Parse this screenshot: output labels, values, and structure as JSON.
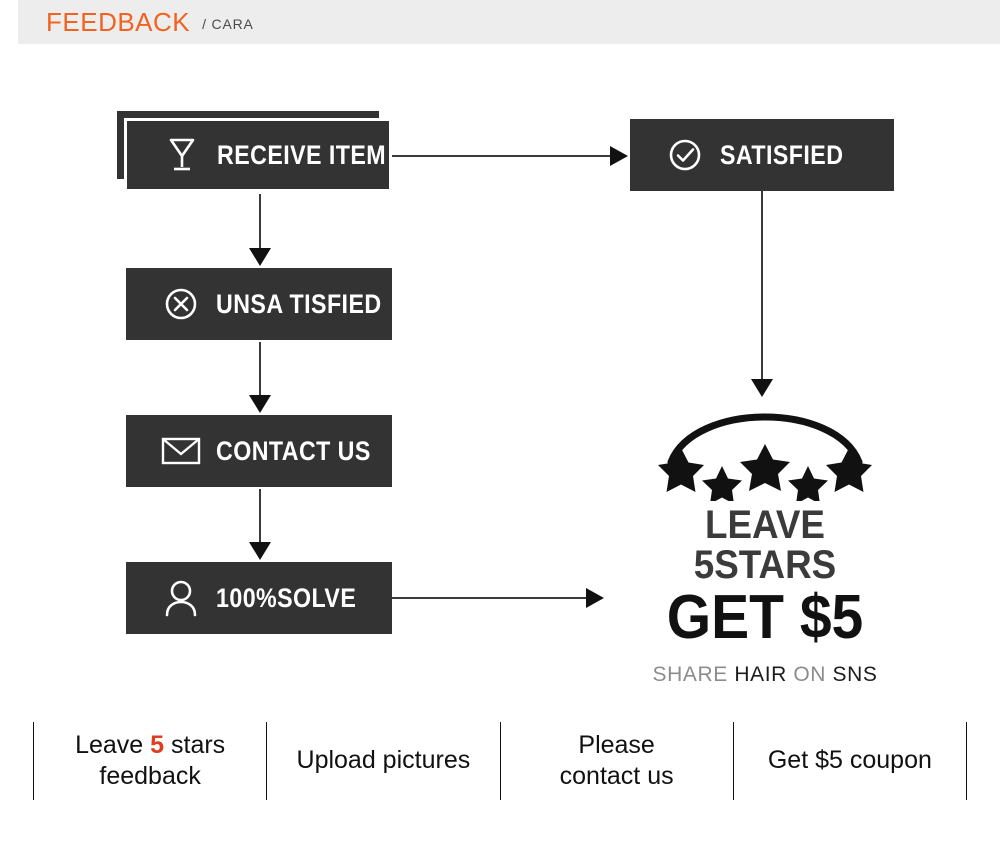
{
  "header": {
    "title": "FEEDBACK",
    "subtitle": "/ CARA",
    "title_color": "#f26322",
    "band_color": "#ededed"
  },
  "flow": {
    "box_color": "#333333",
    "text_color": "#ffffff",
    "boxes": [
      {
        "id": "receive",
        "label": "RECEIVE ITEM",
        "icon": "wine-glass-icon",
        "stacked": true
      },
      {
        "id": "satisfied",
        "label": "SATISFIED",
        "icon": "check-circle-icon",
        "stacked": false
      },
      {
        "id": "unsat",
        "label": "UNSA TISFIED",
        "icon": "x-circle-icon",
        "stacked": false
      },
      {
        "id": "contact",
        "label": "CONTACT US",
        "icon": "envelope-icon",
        "stacked": false
      },
      {
        "id": "solve",
        "label": "100%SOLVE",
        "icon": "person-icon",
        "stacked": false
      }
    ],
    "arrows": [
      {
        "id": "receive-to-satisfied",
        "direction": "right"
      },
      {
        "id": "receive-to-unsatisfied",
        "direction": "down"
      },
      {
        "id": "unsatisfied-to-contact",
        "direction": "down"
      },
      {
        "id": "contact-to-solve",
        "direction": "down"
      },
      {
        "id": "solve-to-stars",
        "direction": "right"
      },
      {
        "id": "satisfied-to-stars",
        "direction": "down"
      }
    ]
  },
  "badge": {
    "stars_count": 5,
    "line1": "LEAVE 5STARS",
    "line2": "GET $5",
    "line3_words": [
      {
        "text": "SHARE",
        "tone": "gray"
      },
      {
        "text": "HAIR",
        "tone": "dark"
      },
      {
        "text": "ON",
        "tone": "gray"
      },
      {
        "text": "SNS",
        "tone": "dark"
      }
    ],
    "line1_color": "#3b3b3b",
    "line2_color": "#111111"
  },
  "bottom": {
    "highlight_color": "#e03c20",
    "cells": [
      {
        "id": "leave-stars",
        "pre": "Leave ",
        "highlight": "5",
        "post": " stars",
        "line2": "feedback"
      },
      {
        "id": "upload-pictures",
        "pre": "Upload pictures",
        "highlight": "",
        "post": "",
        "line2": ""
      },
      {
        "id": "please-contact-us",
        "pre": "Please",
        "highlight": "",
        "post": "",
        "line2": "contact us"
      },
      {
        "id": "get-coupon",
        "pre": "Get $5 coupon",
        "highlight": "",
        "post": "",
        "line2": ""
      }
    ]
  }
}
